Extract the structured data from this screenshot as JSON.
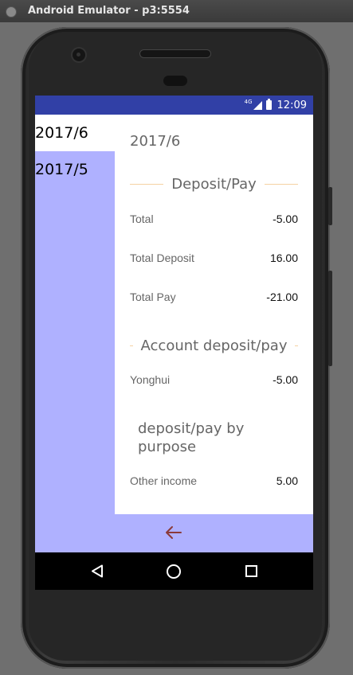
{
  "window": {
    "title": "Android Emulator - p3:5554"
  },
  "statusbar": {
    "network": "4G",
    "time": "12:09"
  },
  "sidebar": {
    "items": [
      {
        "label": "2017/6",
        "selected": true
      },
      {
        "label": "2017/5",
        "selected": false
      }
    ]
  },
  "detail": {
    "month": "2017/6",
    "deposit_pay": {
      "title": "Deposit/Pay",
      "rows": [
        {
          "label": "Total",
          "value": "-5.00"
        },
        {
          "label": "Total Deposit",
          "value": "16.00"
        },
        {
          "label": "Total Pay",
          "value": "-21.00"
        }
      ]
    },
    "account": {
      "title": "Account deposit/pay",
      "rows": [
        {
          "label": "Yonghui",
          "value": "-5.00"
        }
      ]
    },
    "purpose": {
      "title": "deposit/pay by purpose",
      "rows": [
        {
          "label": "Other income",
          "value": "5.00"
        }
      ]
    }
  },
  "icons": {
    "back_arrow": "arrow-left-icon",
    "nav_back": "triangle-back-icon",
    "nav_home": "circle-home-icon",
    "nav_recent": "square-recents-icon"
  },
  "colors": {
    "statusbar": "#3140a6",
    "accent_background": "#afb1ff",
    "section_line": "#f5d2a3",
    "back_arrow": "#8b3a3a"
  }
}
